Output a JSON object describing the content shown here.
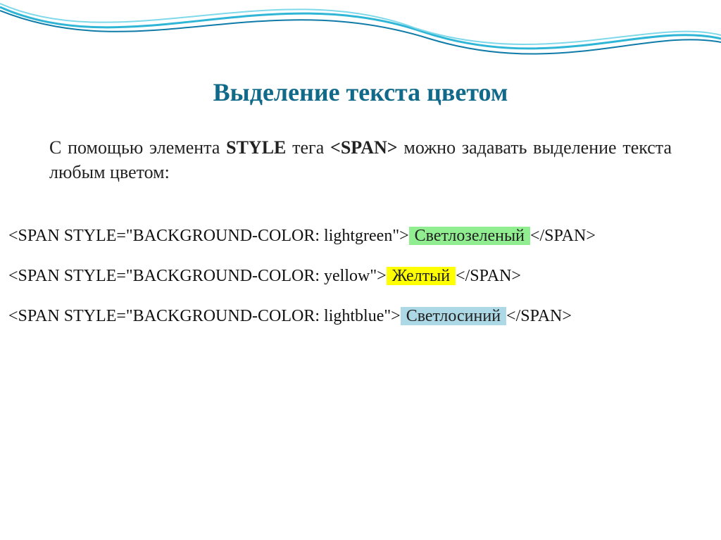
{
  "title": "Выделение текста цветом",
  "intro": {
    "part1": "С помощью элемента ",
    "style": "STYLE",
    "part2": " тега ",
    "span": "<SPAN>",
    "part3": " можно задавать выделение текста любым цветом:"
  },
  "examples": [
    {
      "prefix": "<SPAN STYLE=\"BACKGROUND-COLOR: lightgreen\">",
      "text": " Светлозеленый ",
      "suffix": "</SPAN>",
      "hlClass": "hl-green"
    },
    {
      "prefix": "<SPAN STYLE=\"BACKGROUND-COLOR: yellow\">",
      "text": " Желтый ",
      "suffix": "</SPAN>",
      "hlClass": "hl-yellow"
    },
    {
      "prefix": "<SPAN STYLE=\"BACKGROUND-COLOR: lightblue\">",
      "text": " Светлосиний ",
      "suffix": "</SPAN>",
      "hlClass": "hl-blue"
    }
  ]
}
